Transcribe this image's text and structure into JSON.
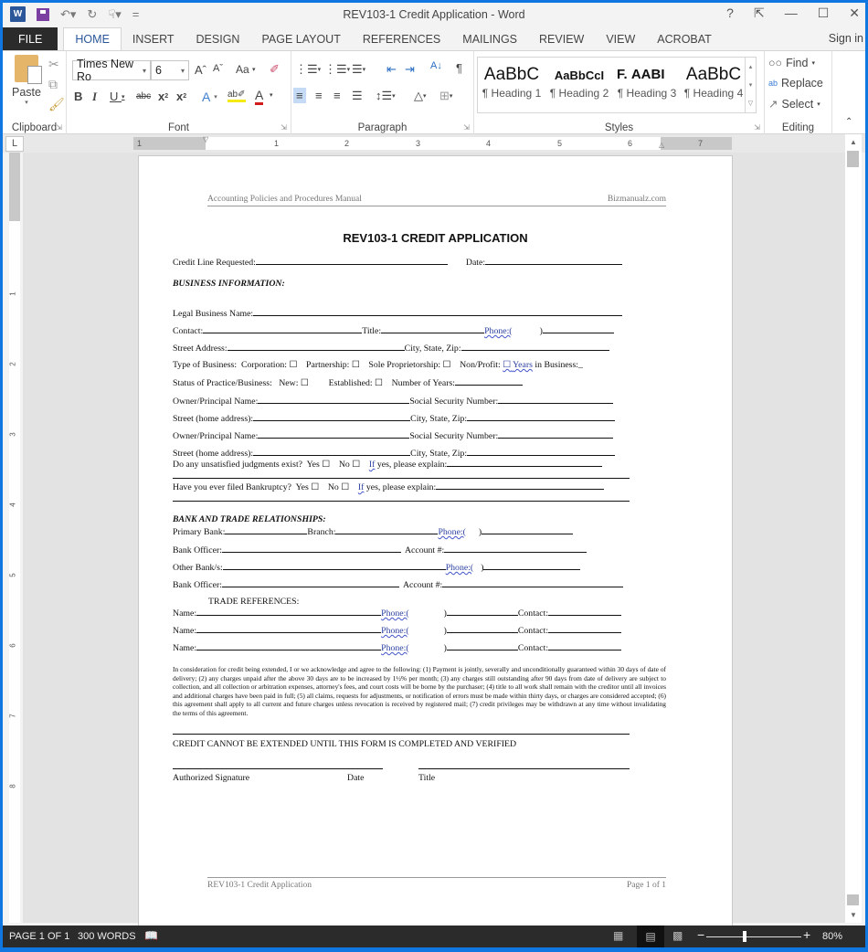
{
  "window": {
    "title": "REV103-1 Credit Application - Word",
    "controls": [
      "?",
      "ribbon-display-options",
      "minimize",
      "maximize",
      "close"
    ],
    "sign_in": "Sign in"
  },
  "quick_access": {
    "app_icon": "W",
    "items": [
      "save-icon",
      "undo-icon",
      "redo-icon",
      "touch-mode-icon",
      "customize-icon"
    ]
  },
  "tabs": [
    {
      "label": "FILE"
    },
    {
      "label": "HOME",
      "active": true
    },
    {
      "label": "INSERT"
    },
    {
      "label": "DESIGN"
    },
    {
      "label": "PAGE LAYOUT"
    },
    {
      "label": "REFERENCES"
    },
    {
      "label": "MAILINGS"
    },
    {
      "label": "REVIEW"
    },
    {
      "label": "VIEW"
    },
    {
      "label": "ACROBAT"
    }
  ],
  "ribbon": {
    "clipboard": {
      "paste": "Paste",
      "label": "Clipboard"
    },
    "font": {
      "name": "Times New Ro",
      "size": "6",
      "label": "Font",
      "case": "Aa",
      "colors": {
        "highlight": "#f5ea14",
        "font": "#d21b1b"
      }
    },
    "paragraph": {
      "label": "Paragraph"
    },
    "styles": {
      "label": "Styles",
      "items": [
        {
          "preview": "AaBbC",
          "name": "¶ Heading 1"
        },
        {
          "preview": "AaBbCcI",
          "name": "¶ Heading 2"
        },
        {
          "preview": "F.",
          "name": "¶ Heading 3"
        },
        {
          "preview": "AABI",
          "name": "¶ Heading 4"
        },
        {
          "preview": "AaBbC",
          "name": ""
        }
      ]
    },
    "editing": {
      "label": "Editing",
      "find": "Find",
      "replace": "Replace",
      "select": "Select"
    }
  },
  "ruler": {
    "h_numbers": [
      "1",
      "1",
      "2",
      "3",
      "4",
      "5",
      "6",
      "7"
    ],
    "v_numbers": [
      "1",
      "2",
      "3",
      "4",
      "5",
      "6",
      "7",
      "8"
    ],
    "tab_selector": "L"
  },
  "document": {
    "header_left": "Accounting Policies and Procedures Manual",
    "header_right": "Bizmanualz.com",
    "title": "REV103-1 CREDIT APPLICATION",
    "credit_line": "Credit Line Requested:",
    "date": "Date:",
    "business_info": "BUSINESS INFORMATION:",
    "legal_name": "Legal Business Name:",
    "contact": "Contact:",
    "title_lbl": "Title:",
    "phone": "Phone:(",
    "phone_close": ")",
    "street_address": "Street Address:",
    "city_state_zip": "City, State, Zip:",
    "type_of_business": "Type of Business:  Corporation: ☐    Partnership: ☐    Sole Proprietorship: ☐    Non/Profit: ",
    "type_box": "☐",
    "type_years": "Years",
    "type_in_business": " in Business:_",
    "status_practice": "Status of Practice/Business:   New: ☐         Established: ☐    Number of Years:",
    "owner_name": "Owner/Principal Name:",
    "ssn": "Social Security Number:",
    "street_home": "Street (home address):",
    "judgments": "Do any unsatisfied judgments exist?  Yes ☐    No ☐    ",
    "if": "If",
    "yes_explain": " yes, please explain:",
    "bankruptcy": "Have you ever filed Bankruptcy?  Yes ☐    No ☐    ",
    "bank_trade": "BANK AND TRADE RELATIONSHIPS:",
    "primary_bank": "Primary Bank:",
    "branch": "Branch:",
    "bank_officer": "Bank Officer:",
    "account": "Account #:",
    "other_banks": "Other Bank/s:",
    "trade_refs": "TRADE REFERENCES:",
    "name": "Name:",
    "contact_lbl": "Contact:",
    "terms": "In consideration for credit being extended, I or we acknowledge and agree to the following: (1) Payment is jointly, severally and unconditionally guaranteed within 30 days of date of delivery; (2) any charges unpaid after the above 30 days are to be increased by 1½% per month; (3) any charges still outstanding after 90 days from date of delivery are subject to collection, and all collection or arbitration expenses, attorney's fees, and court costs will be borne by the purchaser; (4) title to all work shall remain with the creditor until all invoices and additional charges have been paid in full; (5) all claims, requests for adjustments, or notification of errors must be made within thirty days, or charges are considered accepted; (6) this agreement shall apply to all current and future charges unless revocation is received by registered mail; (7) credit privileges may be withdrawn at any time without invalidating the terms of this agreement.",
    "notice": "CREDIT CANNOT BE EXTENDED UNTIL THIS FORM IS COMPLETED AND VERIFIED",
    "auth_sig": "Authorized Signature",
    "sig_date": "Date",
    "sig_title": "Title",
    "footer_left": "REV103-1 Credit Application",
    "footer_right": "Page 1 of 1"
  },
  "status_bar": {
    "page": "PAGE 1 OF 1",
    "words": "300 WORDS",
    "zoom": "80%",
    "zoom_level_percent": 80,
    "minus": "−",
    "plus": "+"
  }
}
